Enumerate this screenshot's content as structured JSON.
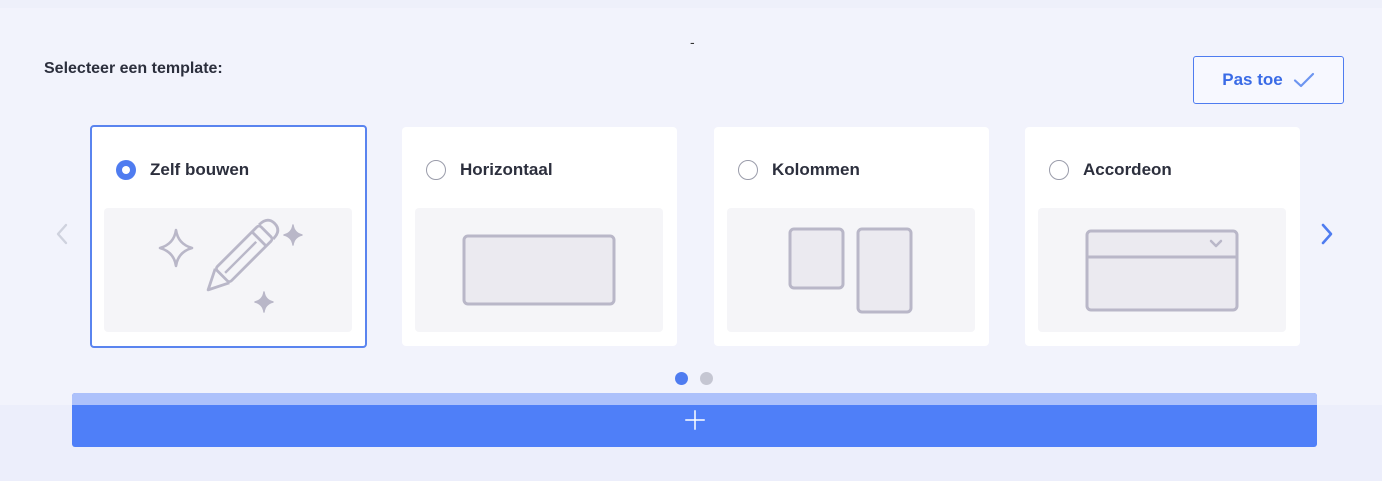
{
  "header": {
    "dash": "-",
    "heading": "Selecteer een template:",
    "apply_label": "Pas toe"
  },
  "templates": [
    {
      "label": "Zelf bouwen",
      "selected": true,
      "icon": "pencil-sparkles-icon"
    },
    {
      "label": "Horizontaal",
      "selected": false,
      "icon": "horizontal-layout-icon"
    },
    {
      "label": "Kolommen",
      "selected": false,
      "icon": "columns-layout-icon"
    },
    {
      "label": "Accordeon",
      "selected": false,
      "icon": "accordion-layout-icon"
    }
  ],
  "carousel": {
    "pages": 2,
    "active_page": 1
  },
  "colors": {
    "accent": "#4f7cf0",
    "background": "#f2f3fc",
    "illustration": "#b9b7c8"
  }
}
